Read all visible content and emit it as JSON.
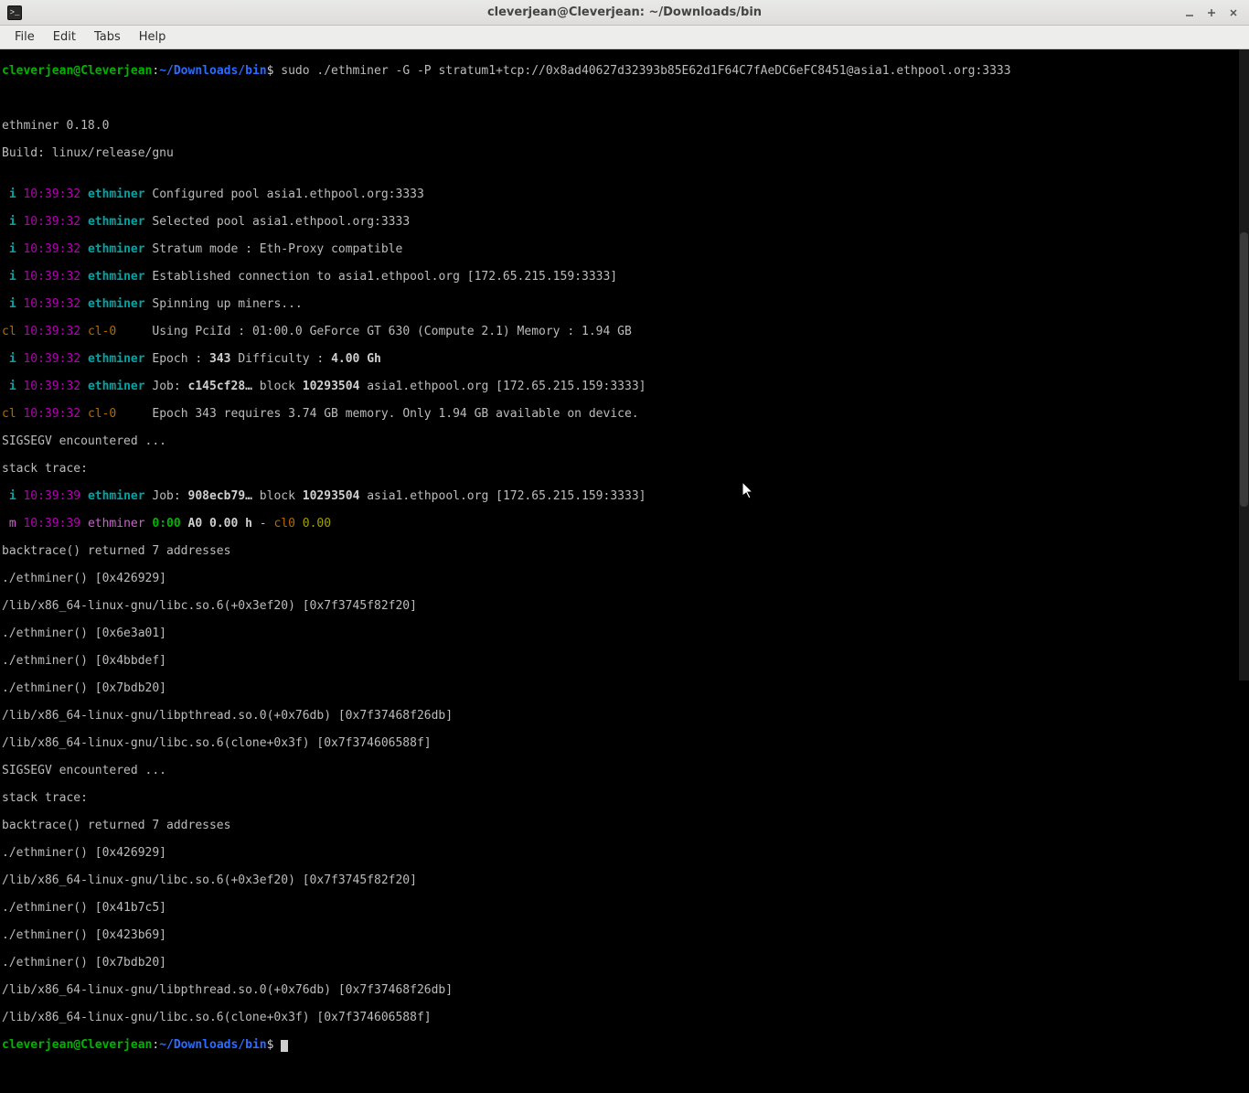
{
  "titlebar": {
    "icon_glyph": ">_",
    "title": "cleverjean@Cleverjean: ~/Downloads/bin"
  },
  "menubar": {
    "file": "File",
    "edit": "Edit",
    "tabs": "Tabs",
    "help": "Help"
  },
  "prompt": {
    "user_host": "cleverjean@Cleverjean",
    "colon": ":",
    "path": "~/Downloads/bin",
    "dollar": "$"
  },
  "cmd": " sudo ./ethminer -G -P stratum1+tcp://0x8ad40627d32393b85E62d1F64C7fAeDC6eFC8451@asia1.ethpool.org:3333",
  "blank": "",
  "version": "ethminer 0.18.0",
  "build": "Build: linux/release/gnu",
  "log": {
    "prefix_i": " i",
    "prefix_cl": "cl",
    "prefix_m": " m",
    "ts32": " 10:39:32 ",
    "ts39": " 10:39:39 ",
    "src_eth": "ethminer",
    "src_cl0": "cl-0    ",
    "l1": " Configured pool asia1.ethpool.org:3333",
    "l2": " Selected pool asia1.ethpool.org:3333",
    "l3": " Stratum mode : Eth-Proxy compatible",
    "l4": " Established connection to asia1.ethpool.org [172.65.215.159:3333]",
    "l5": " Spinning up miners...",
    "l6": " Using PciId : 01:00.0 GeForce GT 630 (Compute 2.1) Memory : 1.94 GB",
    "l7a": " Epoch : ",
    "l7b": "343",
    "l7c": " Difficulty : ",
    "l7d": "4.00 Gh",
    "l8a": " Job: ",
    "l8b": "c145cf28…",
    "l8c": " block ",
    "l8d": "10293504",
    "l8e": " asia1.ethpool.org [172.65.215.159:3333]",
    "l9": " Epoch 343 requires 3.74 GB memory. Only 1.94 GB available on device.",
    "sig": "SIGSEGV encountered ...",
    "trace": "stack trace:",
    "l10b": "908ecb79…",
    "m_a": " ",
    "m_b": "0:00",
    "m_c": " A0",
    "m_d": " 0.00 h",
    "m_e": " - ",
    "m_f": "cl0",
    "m_g": " 0.00",
    "bt7": "backtrace() returned 7 addresses",
    "t1": "./ethminer() [0x426929]",
    "t2": "/lib/x86_64-linux-gnu/libc.so.6(+0x3ef20) [0x7f3745f82f20]",
    "t3": "./ethminer() [0x6e3a01]",
    "t4": "./ethminer() [0x4bbdef]",
    "t5": "./ethminer() [0x7bdb20]",
    "t6": "/lib/x86_64-linux-gnu/libpthread.so.0(+0x76db) [0x7f37468f26db]",
    "t7": "/lib/x86_64-linux-gnu/libc.so.6(clone+0x3f) [0x7f374606588f]",
    "u3": "./ethminer() [0x41b7c5]",
    "u4": "./ethminer() [0x423b69]"
  }
}
